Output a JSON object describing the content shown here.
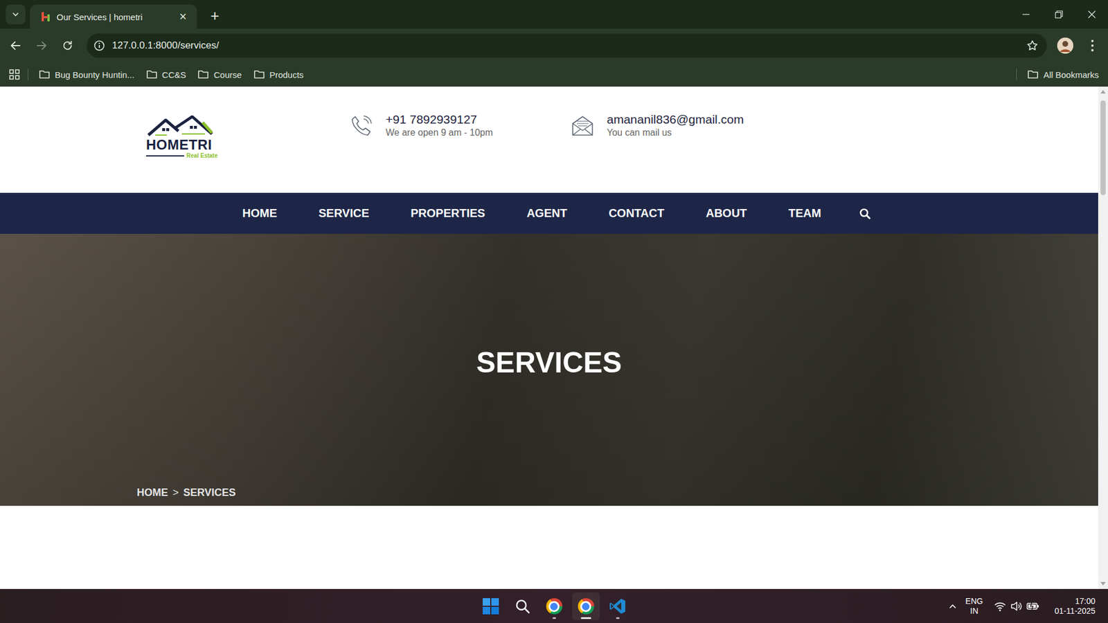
{
  "browser": {
    "tabs": [
      {
        "label": "Our Services | hometri",
        "selected": true,
        "close": "×"
      }
    ],
    "new_tab": "+",
    "address": "127.0.0.1:8000/services/",
    "bookmarks": [
      {
        "label": "Bug Bounty Huntin..."
      },
      {
        "label": "CC&S"
      },
      {
        "label": "Course"
      },
      {
        "label": "Products"
      }
    ],
    "all_bookmarks": "All Bookmarks"
  },
  "header": {
    "logo": {
      "name": "HOMETRI",
      "tagline": "Real Estate"
    },
    "contacts": [
      {
        "kind": "phone",
        "title": "+91 7892939127",
        "subtitle": "We are open 9 am - 10pm"
      },
      {
        "kind": "mail",
        "title": "amananil836@gmail.com",
        "subtitle": "You can mail us"
      }
    ]
  },
  "nav": {
    "items": [
      {
        "label": "HOME"
      },
      {
        "label": "SERVICE"
      },
      {
        "label": "PROPERTIES"
      },
      {
        "label": "AGENT"
      },
      {
        "label": "CONTACT"
      },
      {
        "label": "ABOUT"
      },
      {
        "label": "TEAM"
      }
    ]
  },
  "hero": {
    "title": "SERVICES",
    "breadcrumb": [
      "HOME",
      "SERVICES"
    ],
    "separator": ">"
  },
  "taskbar": {
    "apps": [
      {
        "kind": "start",
        "running": false,
        "active": false
      },
      {
        "kind": "search",
        "running": false,
        "active": false
      },
      {
        "kind": "chrome",
        "running": true,
        "active": false
      },
      {
        "kind": "chrome",
        "running": true,
        "active": true
      },
      {
        "kind": "vscode",
        "running": true,
        "active": false
      }
    ],
    "language": "ENG",
    "region": "IN",
    "time": "17:00",
    "date": "01-11-2025"
  }
}
